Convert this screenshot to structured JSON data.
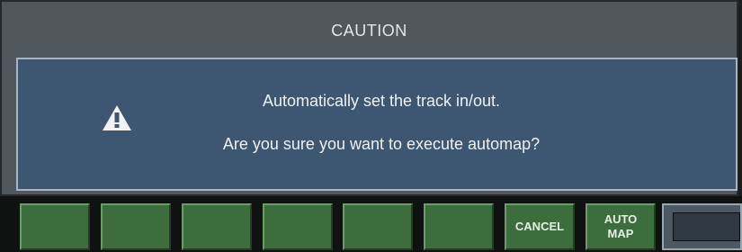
{
  "dialog": {
    "title": "CAUTION",
    "icon": "warning-icon",
    "message_line1": "Automatically set the track in/out.",
    "message_line2": "Are you sure you want to execute automap?"
  },
  "buttons": [
    {
      "label": ""
    },
    {
      "label": ""
    },
    {
      "label": ""
    },
    {
      "label": ""
    },
    {
      "label": ""
    },
    {
      "label": ""
    },
    {
      "label": "CANCEL"
    },
    {
      "label": "AUTO\nMAP"
    }
  ],
  "colors": {
    "dialog_bg": "#50575d",
    "panel_bg": "#3d5672",
    "button_bg": "#3d6d3c",
    "bar_bg": "#0f1210"
  }
}
